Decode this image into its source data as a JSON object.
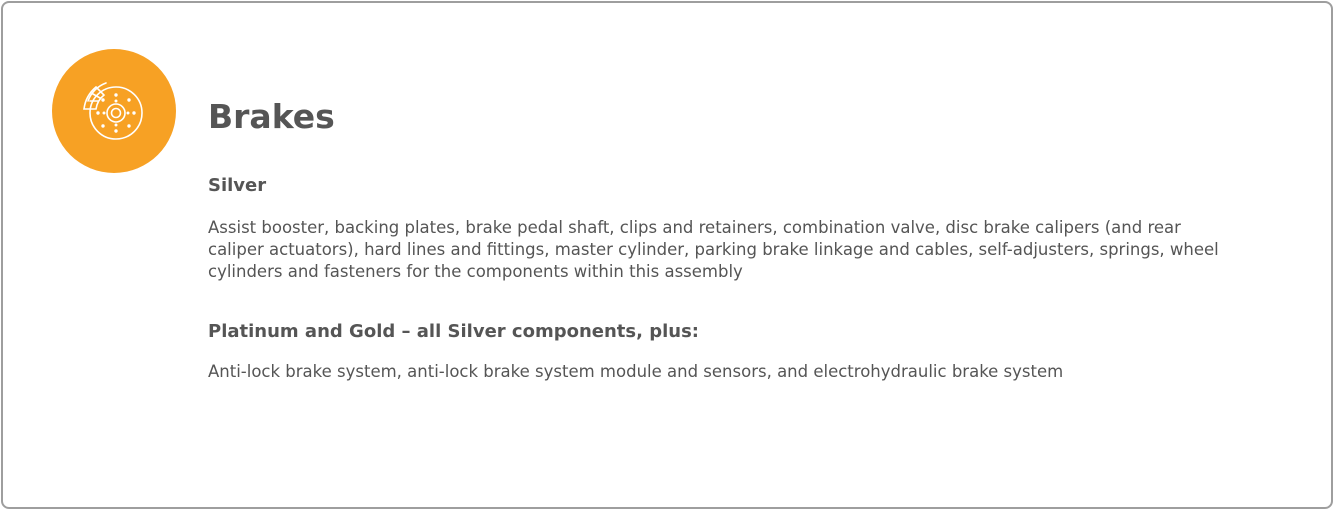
{
  "section": {
    "title": "Brakes",
    "icon": "brake-disc-icon",
    "accent_color": "#f7a124"
  },
  "silver": {
    "heading": "Silver",
    "text": "Assist booster, backing plates, brake pedal shaft, clips and retainers, combination valve, disc brake calipers (and rear caliper actuators), hard lines and fittings, master cylinder, parking brake linkage and cables, self-adjusters, springs, wheel cylinders and fasteners for the components within this assembly"
  },
  "platinum_gold": {
    "heading": "Platinum and Gold – all Silver components, plus:",
    "text": "Anti-lock brake system, anti-lock brake system module and sensors, and electrohydraulic brake system"
  }
}
